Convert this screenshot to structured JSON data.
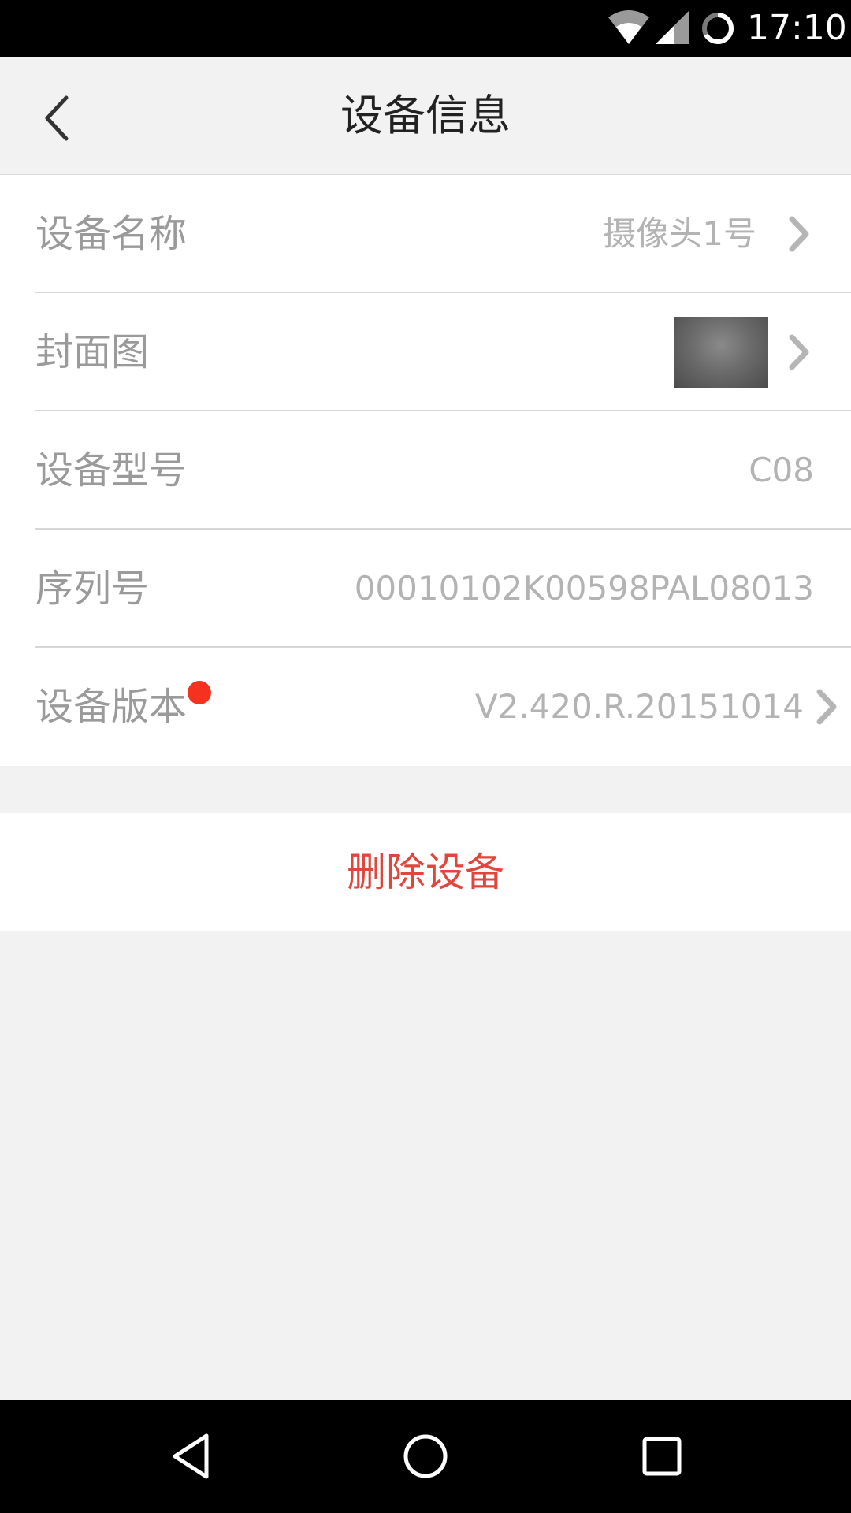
{
  "status_bar": {
    "time": "17:10",
    "icons": [
      "wifi-icon",
      "signal-icon",
      "battery-loading-icon"
    ]
  },
  "header": {
    "title": "设备信息",
    "back_icon": "chevron-left-icon"
  },
  "info": {
    "device_name": {
      "label": "设备名称",
      "value": "摄像头1号"
    },
    "cover": {
      "label": "封面图"
    },
    "model": {
      "label": "设备型号",
      "value": "C08"
    },
    "serial": {
      "label": "序列号",
      "value": "00010102K00598PAL08013"
    },
    "version": {
      "label": "设备版本",
      "value": "V2.420.R.20151014",
      "update_indicator_color": "#f5321f"
    }
  },
  "actions": {
    "delete_label": "删除设备",
    "delete_color": "#e0473c"
  },
  "nav_bar": {
    "icons": [
      "nav-back-icon",
      "nav-home-icon",
      "nav-recents-icon"
    ]
  }
}
